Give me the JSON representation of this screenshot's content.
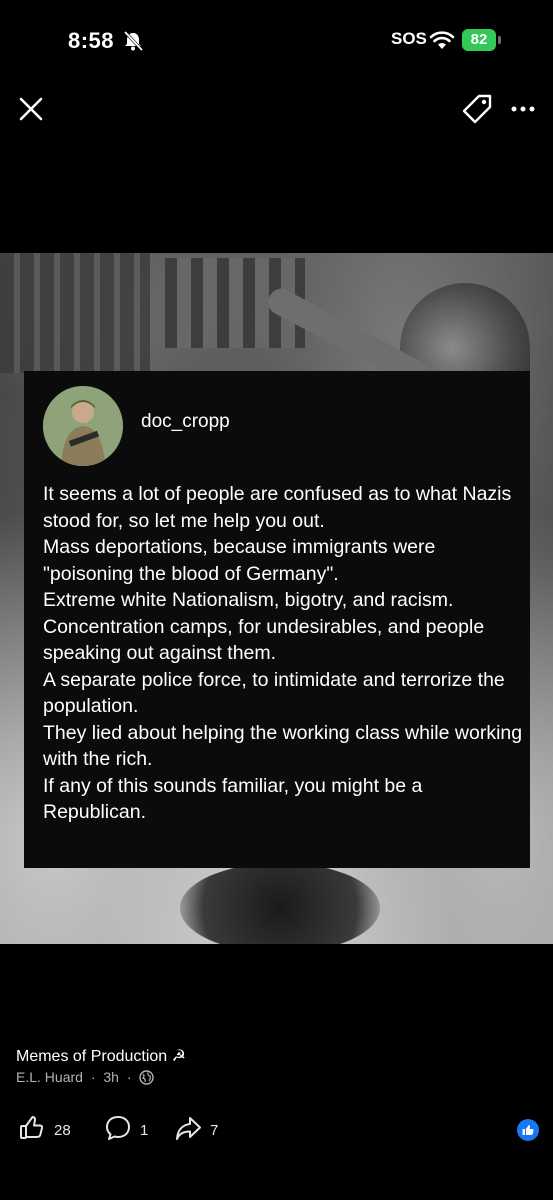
{
  "status_bar": {
    "time": "8:58",
    "carrier": "SOS",
    "battery": "82"
  },
  "post": {
    "author": "doc_cropp",
    "lines": [
      "It seems a lot of people are confused as to what Nazis stood for, so let me help you out.",
      "Mass deportations, because immigrants were \"poisoning the blood of Germany\".",
      "Extreme white Nationalism, bigotry, and racism.",
      "Concentration camps, for undesirables, and people speaking out against them.",
      "A separate police force, to intimidate and terrorize the population.",
      "They lied about helping the working class while working with the rich.",
      "If any of this sounds familiar, you might be a Republican."
    ]
  },
  "footer": {
    "group": "Memes of Production ☭",
    "poster": "E.L. Huard",
    "separator": "·",
    "time_ago": "3h",
    "likes": "28",
    "comments": "1",
    "shares": "7"
  },
  "colors": {
    "battery": "#34c759",
    "facebook_blue": "#1877f2",
    "meta_text": "#b0b3b8"
  }
}
